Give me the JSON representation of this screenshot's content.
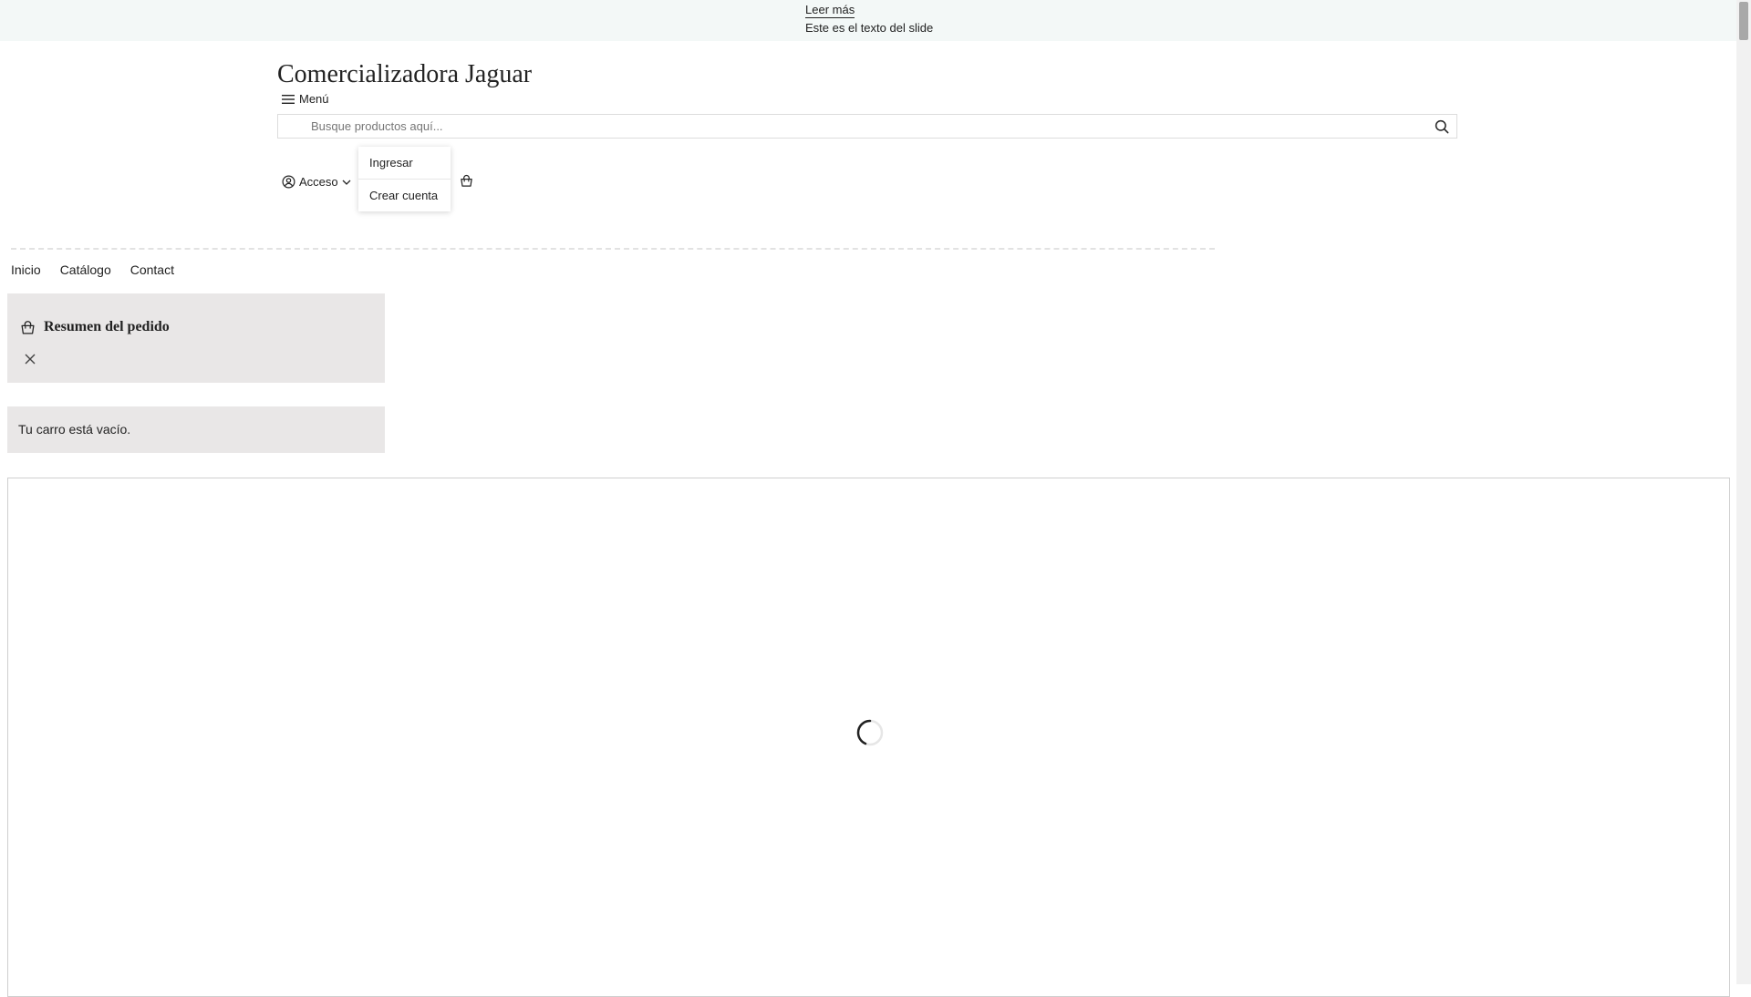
{
  "announcement": {
    "link_label": "Leer más",
    "text": "Este es el texto del slide"
  },
  "header": {
    "store_name": "Comercializadora Jaguar",
    "menu_label": "Menú",
    "search": {
      "placeholder": "Busque productos aquí...",
      "value": ""
    },
    "account_label": "Acceso",
    "account_menu": [
      "Ingresar",
      "Crear cuenta"
    ]
  },
  "nav": {
    "items": [
      "Inicio",
      "Catálogo",
      "Contact"
    ]
  },
  "order_summary": {
    "title": "Resumen del pedido",
    "empty_message": "Tu carro está vacío."
  },
  "icons": {
    "menu": "hamburger-icon",
    "search": "magnifier-icon",
    "account": "user-circle-icon",
    "account_toggle": "chevron-down-icon",
    "cart": "shopping-bag-icon",
    "close": "close-icon",
    "loading": "spinner-icon"
  },
  "colors": {
    "announcement_bg": "#f3f8f7",
    "summary_bg": "#e9e7e7",
    "text": "#222222"
  }
}
